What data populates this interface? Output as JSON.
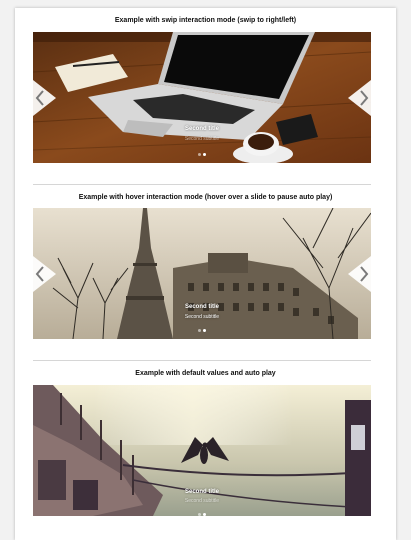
{
  "sections": [
    {
      "title": "Example with swip interaction mode (swip to right/left)",
      "slide_title": "Second title",
      "slide_subtitle": "Second subtitle",
      "dots": 2,
      "active_dot": 1,
      "arrows": true
    },
    {
      "title": "Example with hover interaction mode (hover over a slide to pause auto play)",
      "slide_title": "Second title",
      "slide_subtitle": "Second subtitle",
      "dots": 2,
      "active_dot": 1,
      "arrows": true
    },
    {
      "title": "Example with default values and auto play",
      "slide_title": "Second title",
      "slide_subtitle": "Second subtitle",
      "dots": 2,
      "active_dot": 1,
      "arrows": false
    }
  ],
  "icons": {
    "prev": "chevron-left-icon",
    "next": "chevron-right-icon"
  },
  "colors": {
    "page_bg": "#f2f2f2",
    "card_bg": "#ffffff",
    "arrow_bg": "#ffffff",
    "arrow_chevron": "#7a7a7a"
  }
}
